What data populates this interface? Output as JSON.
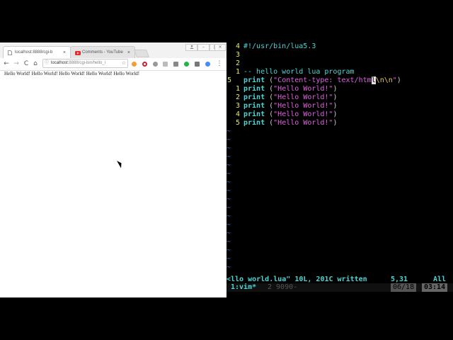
{
  "browser": {
    "tabs": [
      {
        "title": "localhost:8888/cgi-b",
        "active": true
      },
      {
        "title": "Comments - YouTube",
        "active": false
      }
    ],
    "tab_close": "×",
    "window_buttons": {
      "user": "",
      "minimize": "–",
      "maximize": "□",
      "close": "×"
    },
    "nav": {
      "back": "←",
      "forward": "→",
      "reload": "C",
      "home": "⌂"
    },
    "url_host": "localhost:",
    "url_path": "8888/cgi-bin/hello_i",
    "star": "☆",
    "menu": "⋮",
    "page_text": "Hello World! Hello World! Hello World! Hello World! Hello World!",
    "colors": {
      "youtube": "#e52d27",
      "opera": "#cc1f2f",
      "green_ext": "#25b34b",
      "chrome_ext": "#4a8af4"
    }
  },
  "vim": {
    "lines": [
      {
        "num": "4",
        "text": "#!/usr/bin/lua5.3",
        "type": "shebang"
      },
      {
        "num": "3",
        "text": "",
        "type": "blank"
      },
      {
        "num": "2",
        "text": "",
        "type": "blank"
      },
      {
        "num": "1",
        "text": "-- hello world lua program",
        "type": "comment"
      },
      {
        "num": "5",
        "text": "print (\"Content-type: text/html\\n\\n\")",
        "type": "content_type"
      },
      {
        "num": "1",
        "text": "print (\"Hello World!\")",
        "type": "print"
      },
      {
        "num": "2",
        "text": "print (\"Hello World!\")",
        "type": "print"
      },
      {
        "num": "3",
        "text": "print (\"Hello World!\")",
        "type": "print"
      },
      {
        "num": "4",
        "text": "print (\"Hello World!\")",
        "type": "print"
      },
      {
        "num": "5",
        "text": "print (\"Hello World!\")",
        "type": "print"
      }
    ],
    "ct_keyword": "print",
    "ct_open": " (",
    "ct_str_a": "\"Content-type: text/htm",
    "ct_cursor_char": "l",
    "ct_esc": "\\n\\n",
    "ct_str_b": "\"",
    "ct_close": ")",
    "print_keyword": "print",
    "hello_string": "\"Hello World!\"",
    "tilde": "~",
    "tilde_count": 17,
    "status_message": "<llo world.lua\" 10L, 201C written",
    "cursor_position": "5,31",
    "scroll_position": "All"
  },
  "tmux": {
    "window1": "1:vim*",
    "window2": "2 9090-",
    "date": "06/18",
    "time": "03:14"
  }
}
